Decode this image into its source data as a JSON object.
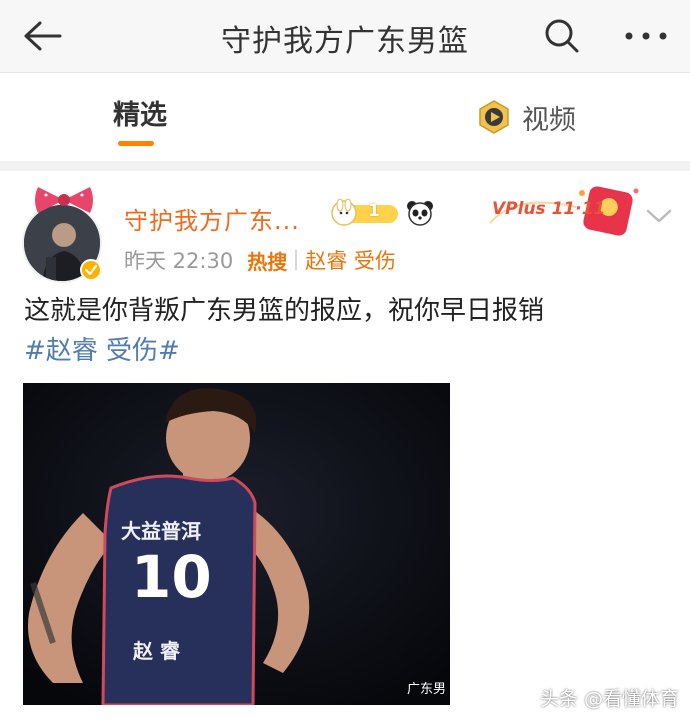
{
  "header": {
    "title": "守护我方广东男篮"
  },
  "tabs": [
    {
      "label": "精选",
      "active": true
    },
    {
      "label": "视频",
      "active": false
    }
  ],
  "post": {
    "username": "守护我方广东...",
    "vip_level": "1",
    "time": "昨天 22:30",
    "hot_label": "热搜",
    "hot_topic": "赵睿 受伤",
    "promo_label": "VPlus 11·11",
    "text": "这就是你背叛广东男篮的报应，祝你早日报销",
    "hashtag": "#赵睿 受伤#",
    "image": {
      "jersey_sponsor": "大益普洱",
      "jersey_number": "10",
      "jersey_name": "赵 睿",
      "caption": "广东男"
    }
  },
  "watermark": "头条 @看懂体育",
  "colors": {
    "accent_orange": "#ff8200",
    "username": "#f26b1d",
    "hashtag": "#507daf",
    "topbar_bg": "#f7f7f7"
  }
}
